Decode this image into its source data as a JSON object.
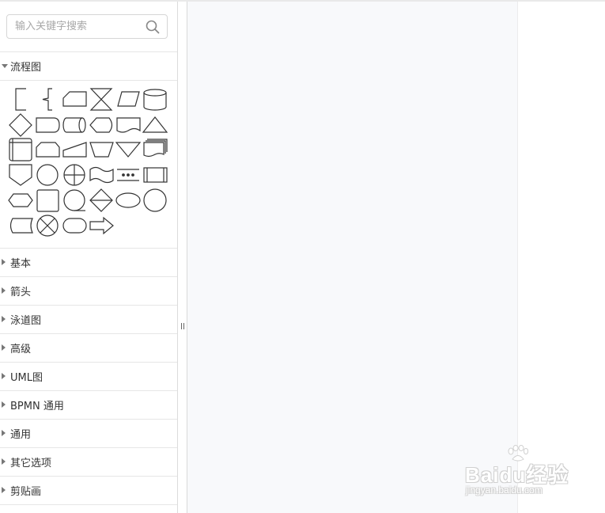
{
  "search": {
    "placeholder": "输入关键字搜索",
    "value": ""
  },
  "sections": {
    "expanded": {
      "label": "流程图",
      "state": "expanded"
    },
    "collapsed": [
      {
        "label": "基本"
      },
      {
        "label": "箭头"
      },
      {
        "label": "泳道图"
      },
      {
        "label": "高级"
      },
      {
        "label": "UML图"
      },
      {
        "label": "BPMN 通用"
      },
      {
        "label": "通用"
      },
      {
        "label": "其它选项"
      },
      {
        "label": "剪贴画"
      }
    ]
  },
  "flowchart_shapes": [
    [
      "bracket-left-shape",
      "brace-annotation-shape",
      "manual-input-shape",
      "collate-shape",
      "parallelogram-shape",
      "database-cylinder-shape"
    ],
    [
      "diamond-decision-shape",
      "terminal-rounded-shape",
      "direct-access-storage-shape",
      "display-shape",
      "document-shape",
      "triangle-merge-shape"
    ],
    [
      "internal-storage-shape",
      "card-shape",
      "manual-operation-slope-shape",
      "trapezoid-shape",
      "inverted-triangle-shape",
      "multi-document-shape"
    ],
    [
      "off-page-connector-shape",
      "circle-connector-shape",
      "summing-junction-shape",
      "punched-tape-shape",
      "dotted-sort-shape",
      "predefined-process-shape"
    ],
    [
      "hexagon-preparation-shape",
      "rounded-square-shape",
      "sequential-data-shape",
      "sort-diamond-shape",
      "ellipse-shape",
      "circle-shape"
    ],
    [
      "stored-data-shape",
      "or-junction-shape",
      "terminator-stadium-shape",
      "arrow-right-shape"
    ]
  ],
  "watermark": {
    "brand": "Baidu经验",
    "url": "jingyan.baidu.com"
  },
  "colors": {
    "stroke": "#333333",
    "canvas": "#f8f9fb",
    "border": "#e6e6e6"
  }
}
